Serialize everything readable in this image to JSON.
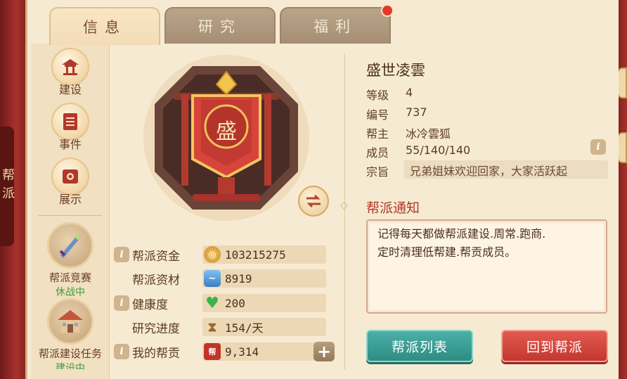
{
  "frame": {
    "side_label": "帮派"
  },
  "tabs": [
    {
      "label": "信息",
      "active": true
    },
    {
      "label": "研究",
      "active": false
    },
    {
      "label": "福利",
      "active": false,
      "badge": true
    }
  ],
  "leftnav": {
    "items": [
      {
        "label": "建设",
        "icon": "pavilion-icon"
      },
      {
        "label": "事件",
        "icon": "scroll-icon"
      },
      {
        "label": "展示",
        "icon": "card-icon"
      }
    ],
    "competition": {
      "label": "帮派竞赛",
      "status": "休战中",
      "icon": "sword-icon"
    },
    "task": {
      "label": "帮派建设任务",
      "status": "建设中",
      "icon": "house-icon"
    }
  },
  "emblem": {
    "character": "盛"
  },
  "resources": [
    {
      "label": "帮派资金",
      "value": "103215275",
      "icon": "gold-coin-icon",
      "has_info": true
    },
    {
      "label": "帮派资材",
      "value": "8919",
      "icon": "material-icon",
      "has_info": false
    },
    {
      "label": "健康度",
      "value": "200",
      "icon": "health-heart-icon",
      "has_info": true
    },
    {
      "label": "研究进度",
      "value": "154/天",
      "icon": "hourglass-icon",
      "has_info": false
    },
    {
      "label": "我的帮贡",
      "value": "9,314",
      "icon": "contribution-badge-icon",
      "has_info": true,
      "icon_text": "帮"
    }
  ],
  "guild": {
    "name": "盛世凌雲",
    "level_label": "等级",
    "level": "4",
    "id_label": "编号",
    "id": "737",
    "leader_label": "帮主",
    "leader": "冰冷雲狐",
    "members_label": "成员",
    "members": "55/140/140",
    "motto_label": "宗旨",
    "motto": "兄弟姐妹欢迎回家，大家活跃起"
  },
  "notice": {
    "title": "帮派通知",
    "text_line1": "记得每天都做帮派建设.周常.跑商.",
    "text_line2": "定时清理低帮建.帮贡成员。"
  },
  "buttons": {
    "guild_list": "帮派列表",
    "return_guild": "回到帮派"
  },
  "colors": {
    "accent_red": "#c3372f",
    "teal": "#2e8c84",
    "parchment": "#f6ead2"
  }
}
